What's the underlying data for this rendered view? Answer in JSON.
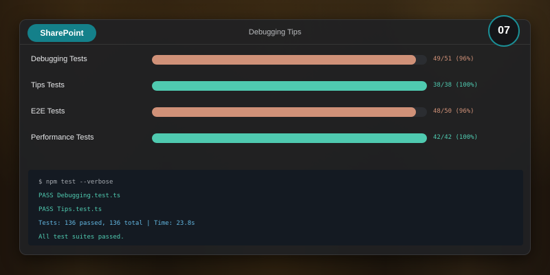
{
  "header": {
    "brand": "SharePoint",
    "title": "Debugging Tips",
    "badge": "07"
  },
  "tests": [
    {
      "name": "Debugging Tests",
      "result": "49/51 (96%)",
      "progress": 0.96,
      "status": "warn"
    },
    {
      "name": "Tips Tests",
      "result": "38/38 (100%)",
      "progress": 1.0,
      "status": "ok"
    },
    {
      "name": "E2E Tests",
      "result": "48/50 (96%)",
      "progress": 0.96,
      "status": "warn"
    },
    {
      "name": "Performance Tests",
      "result": "42/42 (100%)",
      "progress": 1.0,
      "status": "ok"
    }
  ],
  "terminal": {
    "lines": [
      "$ npm test --verbose",
      "PASS Debugging.test.ts",
      "PASS Tips.test.ts",
      "Tests: 136 passed, 136 total | Time: 23.8s",
      "All test suites passed."
    ]
  },
  "colors": {
    "brand": "#14808a",
    "warn": "#d09178",
    "ok": "#4fcab0",
    "summary": "#62b6e0"
  }
}
